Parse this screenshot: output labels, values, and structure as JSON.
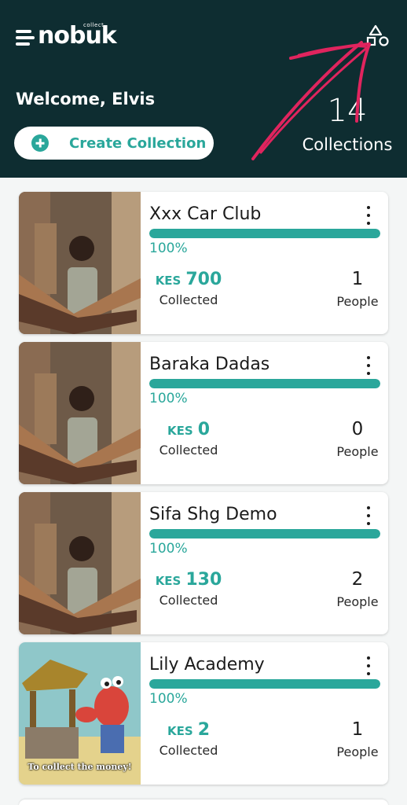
{
  "app": {
    "logo_text": "nobuk",
    "logo_sub": "collect"
  },
  "header": {
    "welcome": "Welcome, Elvis",
    "create_label": "Create Collection",
    "collections_count": "14",
    "collections_label": "Collections",
    "bg_color": "#0e2d31",
    "accent_color": "#2aa79b"
  },
  "icons": {
    "settings": "shapes-settings-icon",
    "menu": "kebab-menu-icon",
    "create": "plus-circle-icon"
  },
  "collections": [
    {
      "title": "Xxx Car Club",
      "progress": 1.0,
      "percent": "100%",
      "currency": "KES",
      "amount": "700",
      "collected_label": "Collected",
      "people": "1",
      "people_label": "People",
      "image": "meme-hands-together"
    },
    {
      "title": "Baraka Dadas",
      "progress": 1.0,
      "percent": "100%",
      "currency": "KES",
      "amount": "0",
      "collected_label": "Collected",
      "people": "0",
      "people_label": "People",
      "image": "meme-hands-together"
    },
    {
      "title": "Sifa Shg Demo",
      "progress": 1.0,
      "percent": "100%",
      "currency": "KES",
      "amount": "130",
      "collected_label": "Collected",
      "people": "2",
      "people_label": "People",
      "image": "meme-hands-together"
    },
    {
      "title": "Lily Academy",
      "progress": 1.0,
      "percent": "100%",
      "currency": "KES",
      "amount": "2",
      "collected_label": "Collected",
      "people": "1",
      "people_label": "People",
      "image": "cartoon-crab-money",
      "image_caption": "To collect the money!"
    }
  ]
}
